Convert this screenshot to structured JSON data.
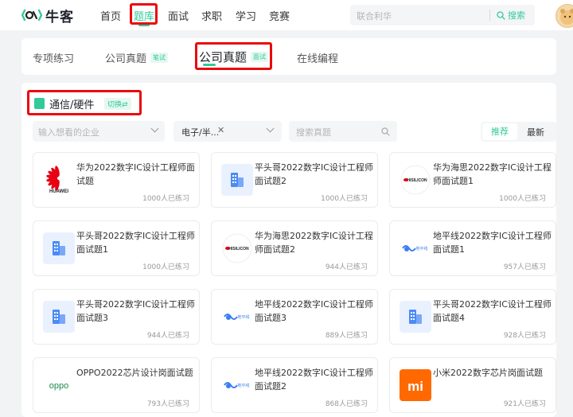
{
  "nav": {
    "logo_text": "牛客",
    "items": [
      "首页",
      "题库",
      "面试",
      "求职",
      "学习",
      "竞赛"
    ],
    "search_placeholder": "联合利华",
    "search_button": "搜索"
  },
  "tabs": [
    {
      "label": "专项练习",
      "tag": ""
    },
    {
      "label": "公司真题",
      "tag": "笔试"
    },
    {
      "label": "公司真题",
      "tag": "面试"
    },
    {
      "label": "在线编程",
      "tag": ""
    }
  ],
  "category": {
    "title": "通信/硬件",
    "switch": "切换⇄"
  },
  "filters": {
    "company_placeholder": "输入想看的企业",
    "field_value": "电子/半...",
    "search_placeholder": "搜索真题",
    "sort_options": [
      "推荐",
      "最新"
    ]
  },
  "questions": [
    {
      "title": "华为2022数字IC设计工程师面试题",
      "count": "1000人已练习",
      "logo": "huawei",
      "logo_text": "HUAWEI"
    },
    {
      "title": "平头哥2022数字IC设计工程师面试题2",
      "count": "1000人已练习",
      "logo": "building",
      "logo_text": ""
    },
    {
      "title": "华为海思2022数字IC设计工程师面试题1",
      "count": "1000人已练习",
      "logo": "hisilicon",
      "logo_text": "HISILICON"
    },
    {
      "title": "平头哥2022数字IC设计工程师面试题1",
      "count": "1000人已练习",
      "logo": "building",
      "logo_text": ""
    },
    {
      "title": "华为海思2022数字IC设计工程师面试题2",
      "count": "944人已练习",
      "logo": "hisilicon",
      "logo_text": "HISILICON"
    },
    {
      "title": "地平线2022数字IC设计工程师面试题1",
      "count": "957人已练习",
      "logo": "horizon",
      "logo_text": "地平线"
    },
    {
      "title": "平头哥2022数字IC设计工程师面试题3",
      "count": "944人已练习",
      "logo": "building",
      "logo_text": ""
    },
    {
      "title": "地平线2022数字IC设计工程师面试题3",
      "count": "889人已练习",
      "logo": "horizon",
      "logo_text": "地平线"
    },
    {
      "title": "平头哥2022数字IC设计工程师面试题4",
      "count": "928人已练习",
      "logo": "building",
      "logo_text": ""
    },
    {
      "title": "OPPO2022芯片设计岗面试题",
      "count": "793人已练习",
      "logo": "oppo",
      "logo_text": "oppo"
    },
    {
      "title": "地平线2022数字IC设计工程师面试题2",
      "count": "868人已练习",
      "logo": "horizon",
      "logo_text": "地平线"
    },
    {
      "title": "小米2022数字芯片岗面试题",
      "count": "921人已练习",
      "logo": "xiaomi",
      "logo_text": "mi"
    }
  ],
  "colors": {
    "accent": "#32ca99",
    "highlight": "#ea0a0a"
  }
}
